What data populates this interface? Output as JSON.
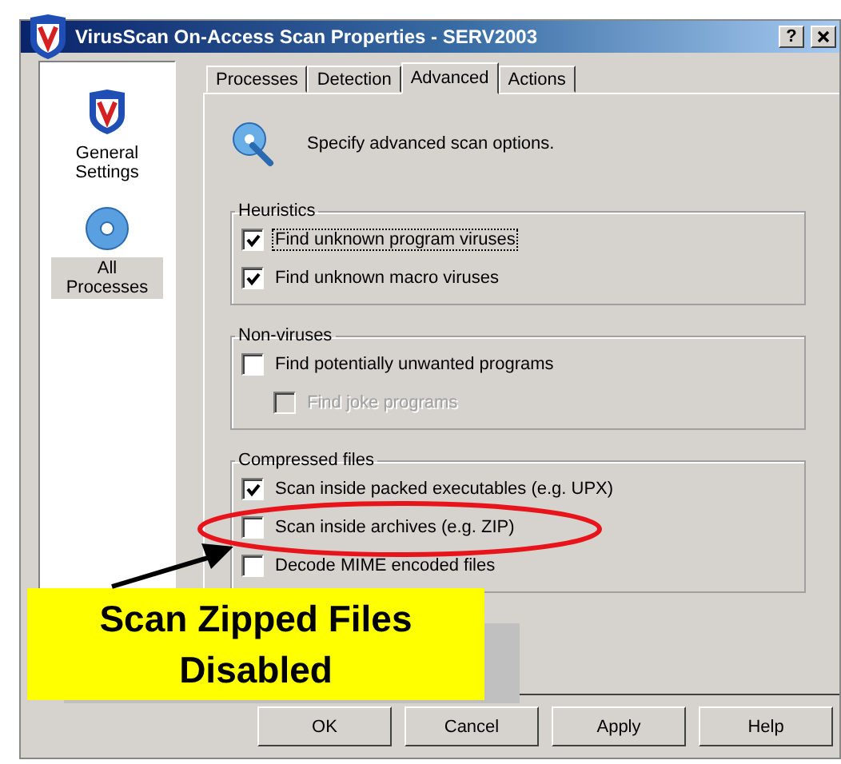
{
  "window": {
    "title": "VirusScan On-Access Scan Properties - SERV2003",
    "help_button": "?"
  },
  "sidebar": {
    "items": [
      {
        "label": "General Settings",
        "selected": false
      },
      {
        "label": "All Processes",
        "selected": true
      }
    ]
  },
  "tabs": [
    {
      "label": "Processes",
      "selected": false
    },
    {
      "label": "Detection",
      "selected": false
    },
    {
      "label": "Advanced",
      "selected": true
    },
    {
      "label": "Actions",
      "selected": false
    }
  ],
  "description": "Specify advanced scan options.",
  "groups": [
    {
      "title": "Heuristics",
      "options": [
        {
          "label": "Find unknown program viruses",
          "checked": true,
          "disabled": false,
          "focused": true
        },
        {
          "label": "Find unknown macro viruses",
          "checked": true,
          "disabled": false,
          "focused": false
        }
      ]
    },
    {
      "title": "Non-viruses",
      "options": [
        {
          "label": "Find potentially unwanted programs",
          "checked": false,
          "disabled": false,
          "focused": false,
          "children": [
            {
              "label": "Find joke programs",
              "checked": false,
              "disabled": true,
              "focused": false
            }
          ]
        }
      ]
    },
    {
      "title": "Compressed files",
      "options": [
        {
          "label": "Scan inside packed executables (e.g. UPX)",
          "checked": true,
          "disabled": false,
          "focused": false
        },
        {
          "label": "Scan inside archives (e.g. ZIP)",
          "checked": false,
          "disabled": false,
          "focused": false
        },
        {
          "label": "Decode MIME encoded files",
          "checked": false,
          "disabled": false,
          "focused": false
        }
      ]
    }
  ],
  "buttons": [
    "OK",
    "Cancel",
    "Apply",
    "Help"
  ],
  "callout": {
    "text": "Scan Zipped Files Disabled"
  }
}
